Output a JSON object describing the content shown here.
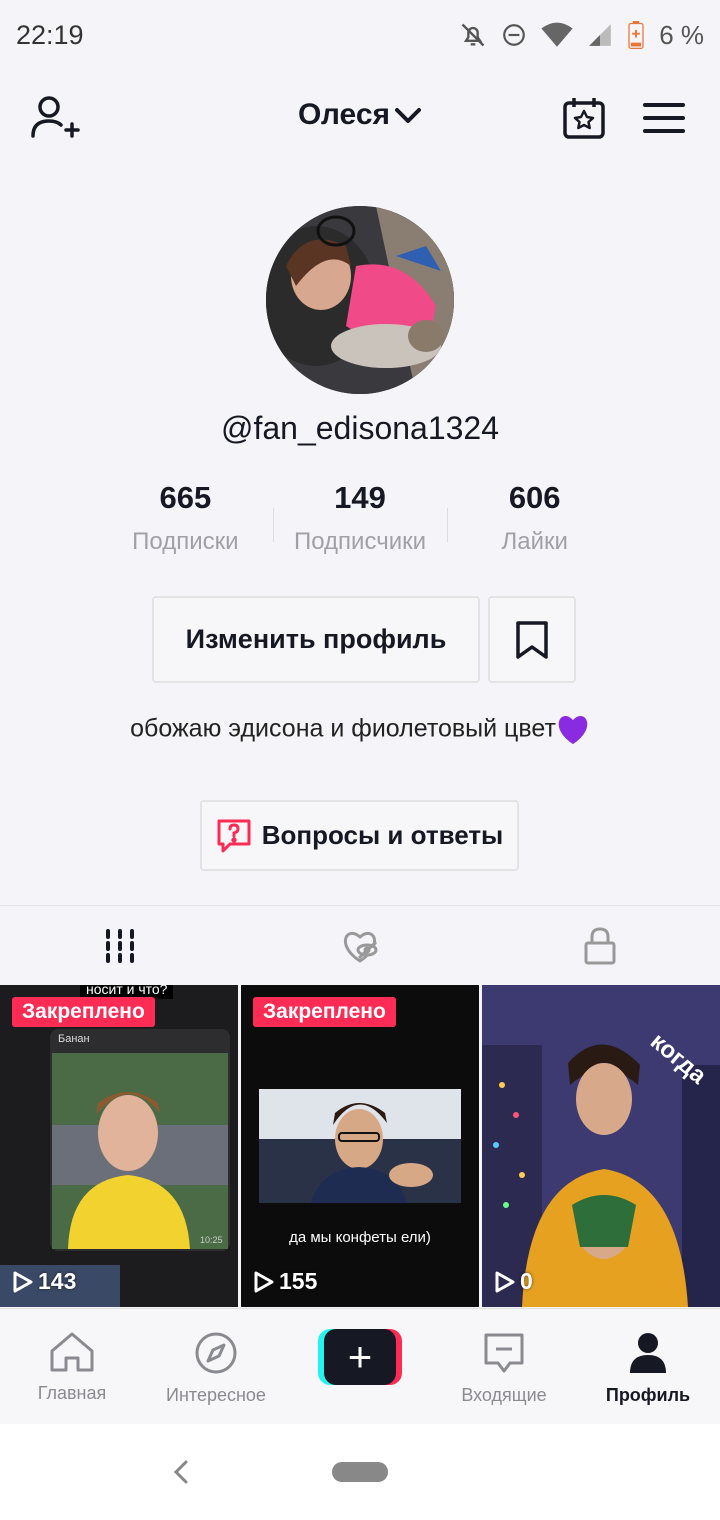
{
  "status_bar": {
    "time": "22:19",
    "battery": "6 %",
    "icons": [
      "bell-off-icon",
      "do-not-disturb-icon",
      "wifi-icon",
      "signal-icon",
      "battery-icon"
    ]
  },
  "header": {
    "title": "Олеся",
    "icons": [
      "add-user-icon",
      "chevron-down-icon",
      "calendar-star-icon",
      "menu-icon"
    ]
  },
  "profile": {
    "username": "@fan_edisona1324",
    "stats": [
      {
        "value": "665",
        "label": "Подписки"
      },
      {
        "value": "149",
        "label": "Подписчики"
      },
      {
        "value": "606",
        "label": "Лайки"
      }
    ],
    "edit_button": "Изменить профиль",
    "bio": "обожаю эдисона и фиолетовый цвет",
    "bio_emoji": "purple-heart",
    "qa_button": "Вопросы и ответы"
  },
  "tabs": [
    {
      "icon": "grid-icon",
      "active": true
    },
    {
      "icon": "liked-hidden-icon",
      "active": false
    },
    {
      "icon": "lock-icon",
      "active": false
    }
  ],
  "videos": [
    {
      "pinned": "Закреплено",
      "plays": "143",
      "caption_top": "носит и что?",
      "inner_title": "Банан",
      "inner_time": "10:25"
    },
    {
      "pinned": "Закреплено",
      "plays": "155",
      "caption": "да мы конфеты ели)"
    },
    {
      "plays": "0",
      "caption": "когда"
    }
  ],
  "bottom_nav": [
    {
      "label": "Главная",
      "icon": "home-icon"
    },
    {
      "label": "Интересное",
      "icon": "compass-icon"
    },
    {
      "label": "",
      "icon": "plus-icon"
    },
    {
      "label": "Входящие",
      "icon": "inbox-icon"
    },
    {
      "label": "Профиль",
      "icon": "profile-icon",
      "active": true
    }
  ],
  "colors": {
    "accent": "#fe2c55",
    "cyan": "#25f4ee",
    "text": "#161823",
    "muted": "#a0a0a6",
    "purple": "#8a2be2"
  }
}
